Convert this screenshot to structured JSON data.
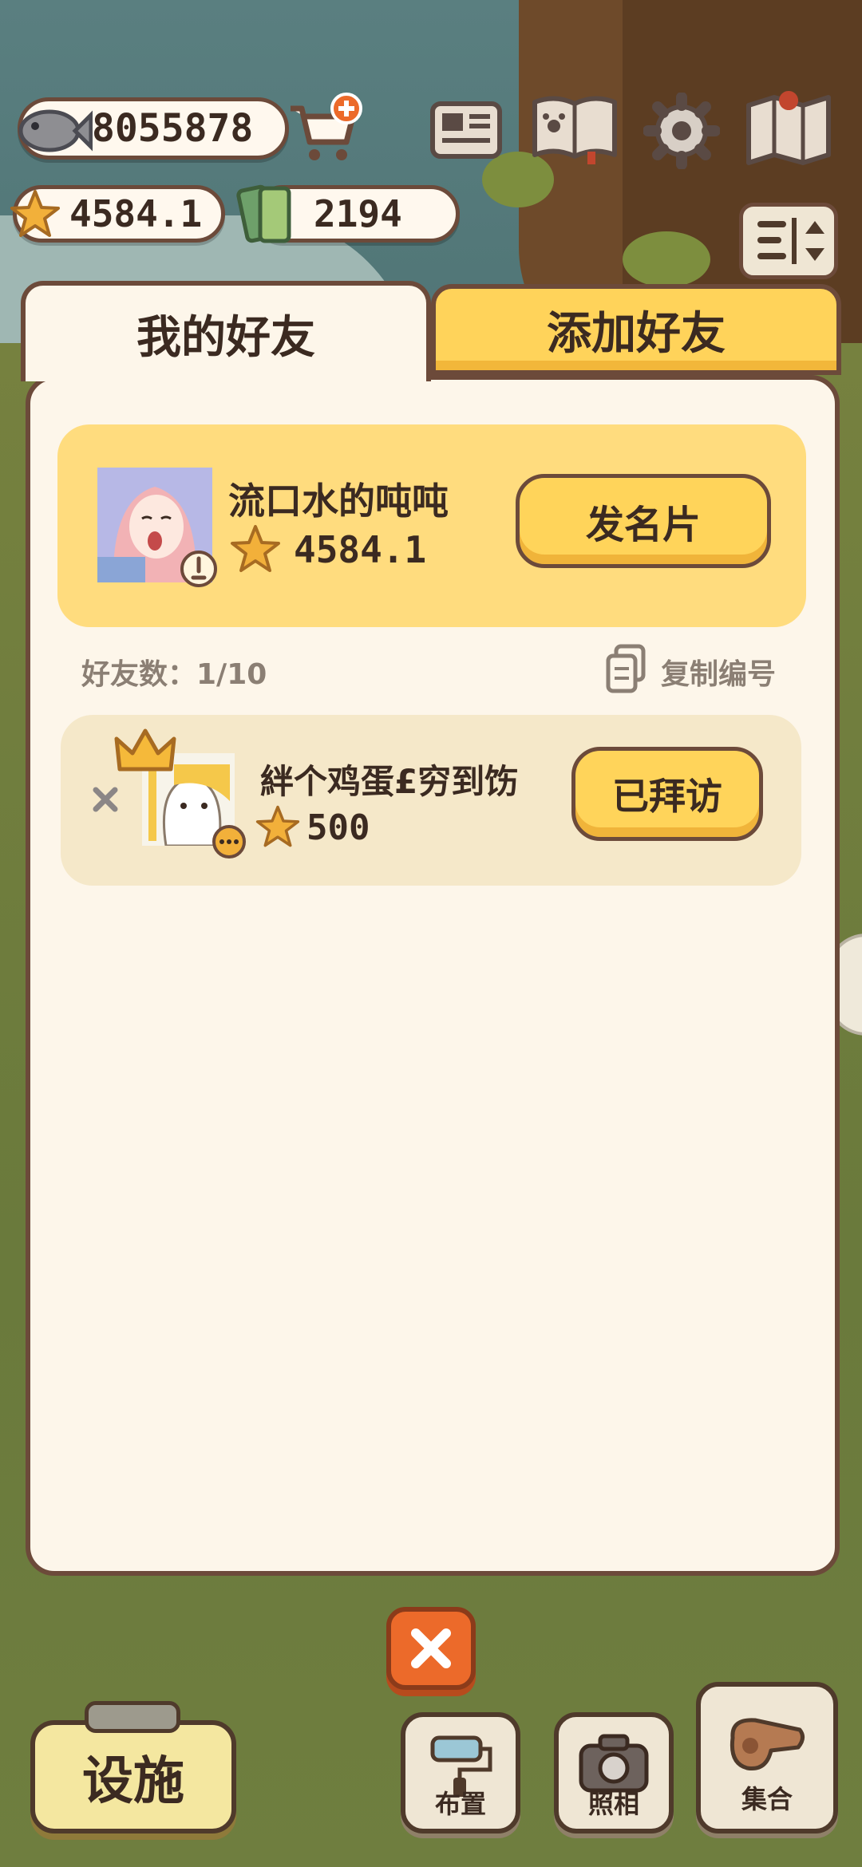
{
  "hud": {
    "fish_count": "8055878",
    "star_count": "4584.1",
    "ticket_count": "2194"
  },
  "tabs": {
    "my_friends": "我的好友",
    "add_friend": "添加好友"
  },
  "my_card": {
    "name": "流口水的吨吨",
    "score": "4584.1",
    "send_card_label": "发名片"
  },
  "friend_meta": {
    "friend_count": "好友数：1/10",
    "copy_id_label": "复制编号"
  },
  "friends": [
    {
      "name": "絆个鸡蛋£穷到饬",
      "score": "500",
      "visited_label": "已拜访"
    }
  ],
  "bottom": {
    "facility_label": "设施",
    "layout_label": "布置",
    "photo_label": "照相",
    "gather_label": "集合"
  },
  "colors": {
    "accent_yellow": "#ffd45a",
    "border_brown": "#6c4a3a",
    "panel_cream": "#fdf6ea",
    "close_orange": "#ec6a2a"
  },
  "icons": [
    "fish-icon",
    "cart-add-icon",
    "star-icon",
    "ticket-icon",
    "newspaper-icon",
    "paw-book-icon",
    "gear-icon",
    "map-icon",
    "sort-icon",
    "copy-icon",
    "remove-icon",
    "close-icon",
    "clipboard-icon",
    "paint-roller-icon",
    "camera-icon",
    "whistle-icon"
  ]
}
